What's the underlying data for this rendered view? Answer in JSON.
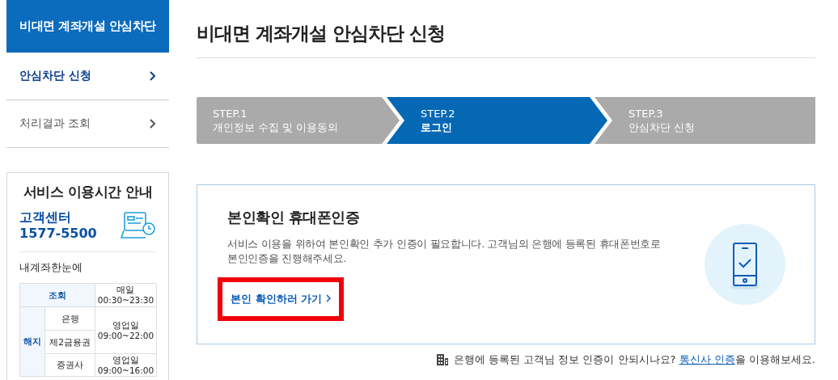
{
  "sidebar": {
    "title": "비대면 계좌개설 안심차단",
    "items": [
      {
        "label": "안심차단 신청",
        "selected": true
      },
      {
        "label": "처리결과 조회",
        "selected": false
      }
    ],
    "service_box": {
      "title": "서비스 이용시간 안내",
      "center_label": "고객센터",
      "center_phone": "1577-5500",
      "subtitle": "내계좌한눈에",
      "table": {
        "inquiry": {
          "label": "조회",
          "time": "매일\n00:30~23:30"
        },
        "cancel": {
          "label": "해지",
          "rows": [
            {
              "label": "은행"
            },
            {
              "label": "제2금융권"
            },
            {
              "label": "증권사"
            }
          ],
          "bank_time": "영업일\n09:00~22:00",
          "securities_time": "영업일\n09:00~16:00"
        }
      }
    }
  },
  "page_title": "비대면 계좌개설 안심차단 신청",
  "steps": [
    {
      "label": "STEP.1",
      "title": "개인정보 수집 및 이용동의",
      "selected": false
    },
    {
      "label": "STEP.2",
      "title": "로그인",
      "selected": true
    },
    {
      "label": "STEP.3",
      "title": "안심차단 신청",
      "selected": false
    }
  ],
  "card": {
    "title": "본인확인 휴대폰인증",
    "description": "서비스 이용을 위하여 본인확인 추가 인증이 필요합니다. 고객님의 은행에 등록된 휴대폰번호로\n본인인증을 진행해주세요.",
    "link": {
      "label": "본인 확인하러 가기",
      "highlighted": true
    }
  },
  "footer_note": {
    "before": "은행에 등록된 고객님 정보 인증이 안되시나요?",
    "link": "통신사 인증",
    "after": "을 이용해보세요."
  }
}
